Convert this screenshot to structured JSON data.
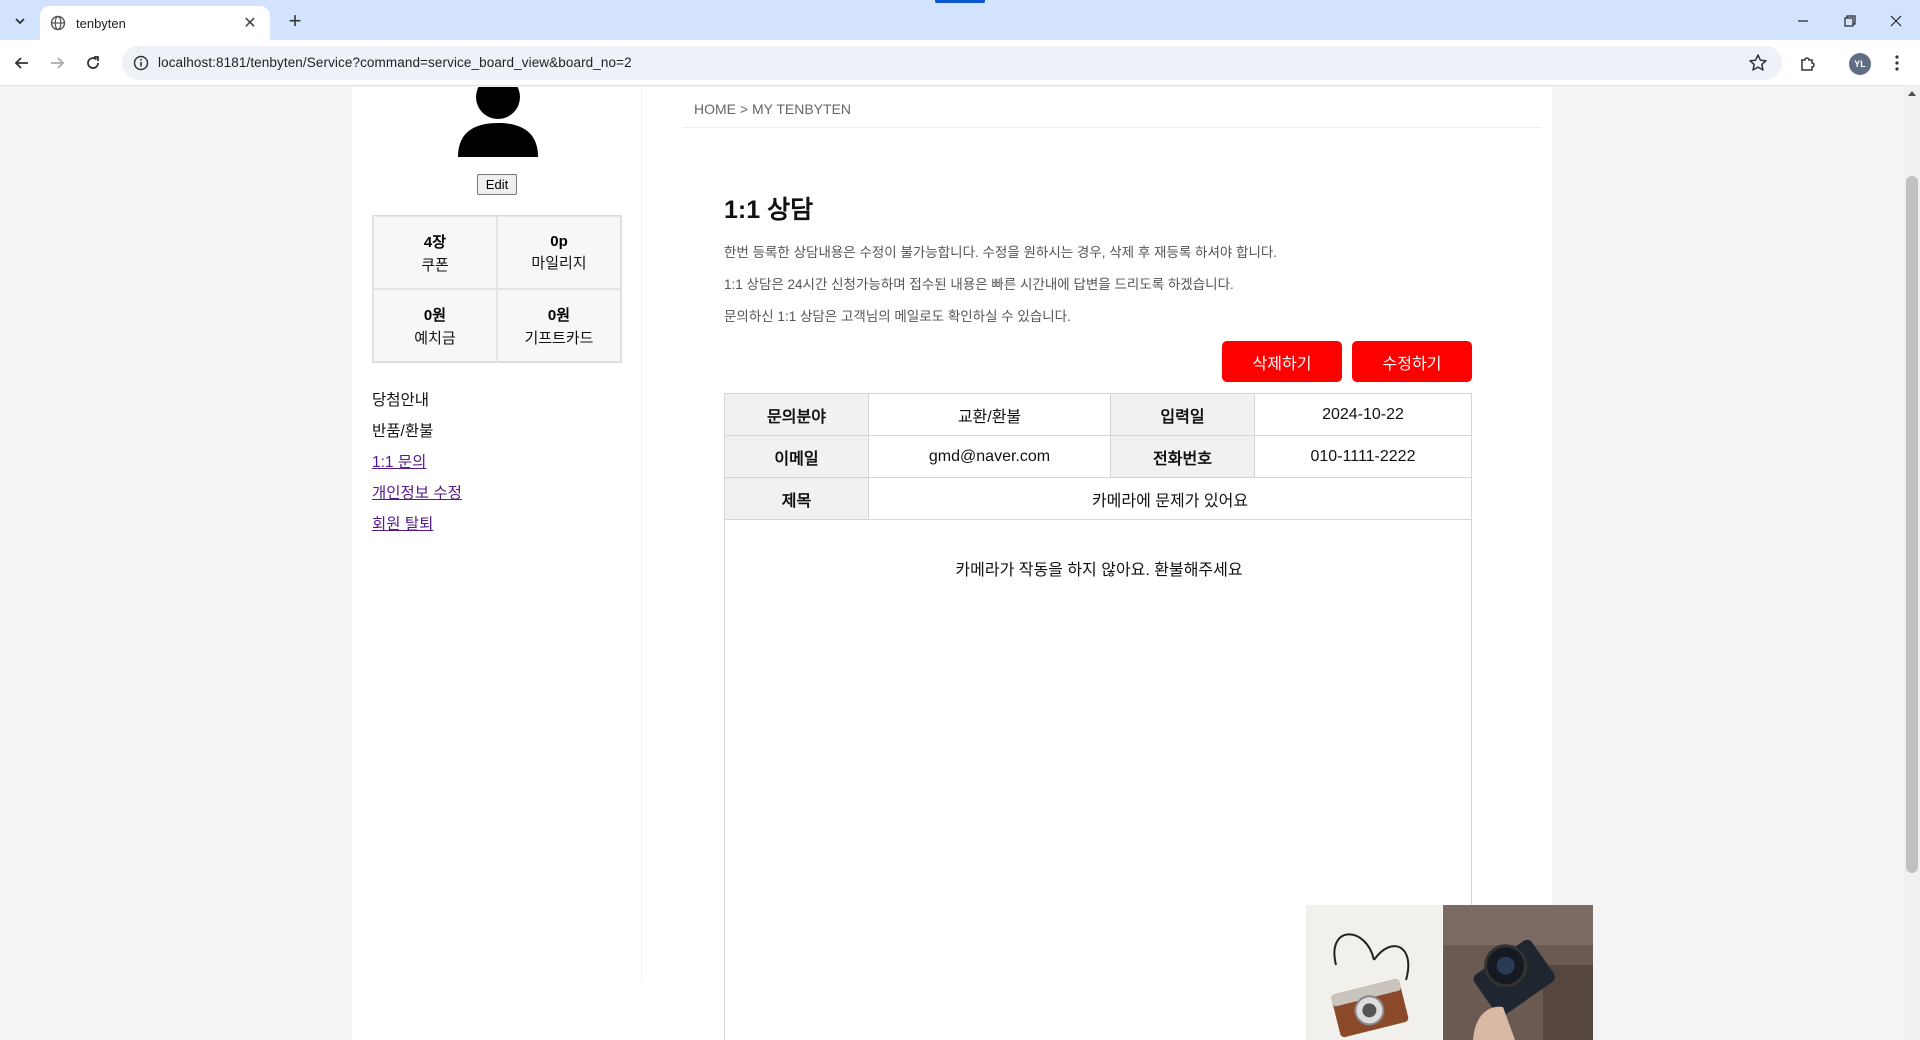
{
  "browser": {
    "tab_title": "tenbyten",
    "url": "localhost:8181/tenbyten/Service?command=service_board_view&board_no=2",
    "profile_initials": "YL"
  },
  "sidebar": {
    "edit_label": "Edit",
    "stats": [
      {
        "value": "4장",
        "label": "쿠폰"
      },
      {
        "value": "0p",
        "label": "마일리지"
      },
      {
        "value": "0원",
        "label": "예치금"
      },
      {
        "value": "0원",
        "label": "기프트카드"
      }
    ],
    "menu": [
      {
        "label": "당첨안내"
      },
      {
        "label": "반품/환불"
      },
      {
        "label": "1:1 문의"
      },
      {
        "label": "개인정보 수정"
      },
      {
        "label": "회원 탈퇴"
      }
    ]
  },
  "main": {
    "breadcrumb": "HOME > MY TENBYTEN",
    "title": "1:1 상담",
    "notes": [
      "한번 등록한 상담내용은 수정이 불가능합니다. 수정을 원하시는 경우, 삭제 후 재등록 하셔야 합니다.",
      "1:1 상담은 24시간 신청가능하며 접수된 내용은 빠른 시간내에 답변을 드리도록 하겠습니다.",
      "문의하신 1:1 상담은 고객님의 메일로도 확인하실 수 있습니다."
    ],
    "delete_label": "삭제하기",
    "edit_label": "수정하기",
    "table": {
      "category_label": "문의분야",
      "category_value": "교환/환불",
      "date_label": "입력일",
      "date_value": "2024-10-22",
      "email_label": "이메일",
      "email_value": "gmd@naver.com",
      "phone_label": "전화번호",
      "phone_value": "010-1111-2222",
      "subject_label": "제목",
      "subject_value": "카메라에 문제가 있어요"
    },
    "body": "카메라가 작동을 하지 않아요. 환불해주세요"
  },
  "colors": {
    "accent": "#ff0000",
    "tabbar": "#d3e3fd"
  }
}
